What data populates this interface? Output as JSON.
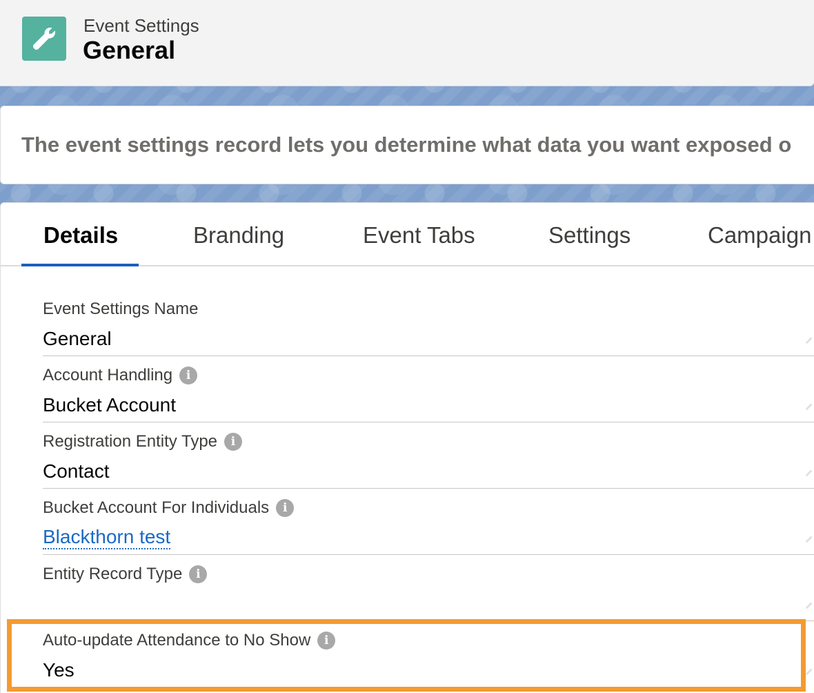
{
  "header": {
    "icon": "wrench-icon",
    "icon_color": "#54b29f",
    "eyebrow": "Event Settings",
    "title": "General"
  },
  "description": {
    "text": "The event settings record lets you determine what data you want exposed o"
  },
  "tabs": [
    {
      "label": "Details",
      "active": true
    },
    {
      "label": "Branding",
      "active": false
    },
    {
      "label": "Event Tabs",
      "active": false
    },
    {
      "label": "Settings",
      "active": false
    },
    {
      "label": "Campaign",
      "active": false
    }
  ],
  "fields": [
    {
      "label": "Event Settings Name",
      "value": "General",
      "info": false,
      "link": false
    },
    {
      "label": "Account Handling",
      "value": "Bucket Account",
      "info": true,
      "link": false
    },
    {
      "label": "Registration Entity Type",
      "value": "Contact",
      "info": true,
      "link": false
    },
    {
      "label": "Bucket Account For Individuals",
      "value": "Blackthorn test",
      "info": true,
      "link": true
    },
    {
      "label": "Entity Record Type",
      "value": "",
      "info": true,
      "link": false
    },
    {
      "label": "Auto-update Attendance to No Show",
      "value": "Yes",
      "info": true,
      "link": false,
      "highlighted": true
    }
  ],
  "colors": {
    "accent": "#1b5fbd",
    "link": "#1b69c6",
    "highlight": "#f39b32"
  }
}
